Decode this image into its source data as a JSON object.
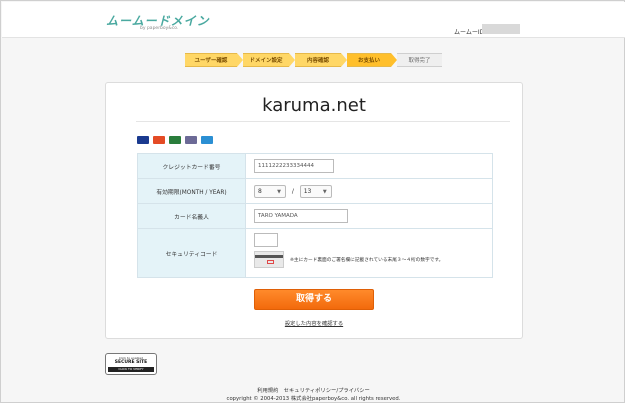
{
  "header": {
    "logo_text": "ムームードメイン",
    "logo_sub": "by paperboy&co.",
    "user_id_label": "ムームーID"
  },
  "steps": [
    "ユーザー確認",
    "ドメイン設定",
    "内容確認",
    "お支払い",
    "取得完了"
  ],
  "colors": {
    "step": "#ffd766",
    "step_current": "#ffbf2b",
    "submit": "#f26a0c",
    "label_bg": "#e4f3f8"
  },
  "card": {
    "site_name": "karuma.net",
    "brands": [
      "VISA",
      "MasterCard",
      "JCB",
      "Diners",
      "AMEX"
    ]
  },
  "form": {
    "card_number_label": "クレジットカード番号",
    "card_number_value": "1111222233334444",
    "expiry_label": "有効期限(MONTH / YEAR)",
    "expiry_month": "8",
    "expiry_slash": "/",
    "expiry_year": "13",
    "holder_label": "カード名義人",
    "holder_value": "TARO YAMADA",
    "security_label": "セキュリティコード",
    "security_value": "",
    "security_note": "※主にカード裏面のご署名欄に記載されている末尾３～４桁の数字です。"
  },
  "actions": {
    "submit_label": "取得する",
    "confirm_link": "設定した内容を確認する"
  },
  "seal": {
    "top": "Click to enabled",
    "title": "SECURE SITE",
    "sub": "SSL by AlphaSSL",
    "bar": "CLICK TO VERIFY"
  },
  "footer": {
    "links": "利用規約　セキュリティポリシー/プライバシー",
    "copyright": "copyright © 2004-2013 株式会社paperboy&co. all rights reserved."
  }
}
